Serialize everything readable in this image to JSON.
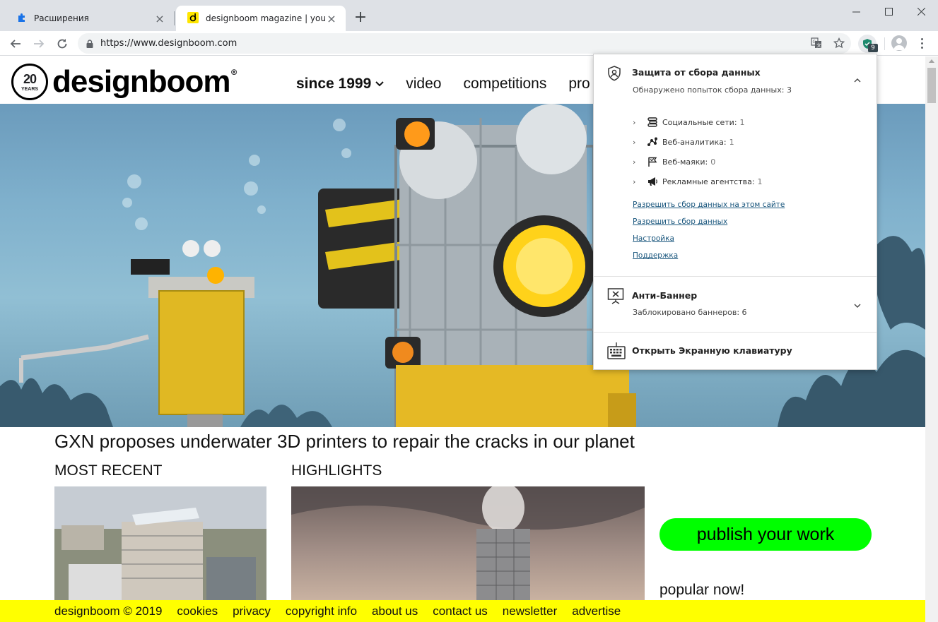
{
  "browser": {
    "tabs": [
      {
        "title": "Расширения",
        "active": false
      },
      {
        "title": "designboom magazine | your firs",
        "active": true
      }
    ],
    "url": "https://www.designboom.com",
    "extension_badge": "9"
  },
  "site": {
    "logo": {
      "years_number": "20",
      "years_label": "YEARS",
      "wordmark": "designboom",
      "registered": "®"
    },
    "nav": [
      "since 1999",
      "video",
      "competitions",
      "pro"
    ],
    "headline": "GXN proposes underwater 3D printers to repair the cracks in our planet",
    "most_recent": "MOST RECENT",
    "highlights": "HIGHLIGHTS",
    "publish_button": "publish your work",
    "popular": "popular now!",
    "footer": [
      "designboom © 2019",
      "cookies",
      "privacy",
      "copyright info",
      "about us",
      "contact us",
      "newsletter",
      "advertise"
    ]
  },
  "popup": {
    "tracking": {
      "title": "Защита от сбора данных",
      "subtitle": "Обнаружено попыток сбора данных: 3",
      "categories": [
        {
          "label": "Социальные сети:",
          "count": "1",
          "icon": "social-networks-icon"
        },
        {
          "label": "Веб-аналитика:",
          "count": "1",
          "icon": "web-analytics-icon"
        },
        {
          "label": "Веб-маяки:",
          "count": "0",
          "icon": "web-beacons-icon"
        },
        {
          "label": "Рекламные агентства:",
          "count": "1",
          "icon": "ad-agencies-icon"
        }
      ],
      "links": [
        "Разрешить сбор данных на этом сайте",
        "Разрешить сбор данных",
        "Настройка",
        "Поддержка"
      ]
    },
    "anti_banner": {
      "title": "Анти-Баннер",
      "subtitle": "Заблокировано баннеров: 6"
    },
    "keyboard": "Открыть Экранную клавиатуру"
  },
  "colors": {
    "publish_green": "#00ff00",
    "footer_yellow": "#ffff00",
    "link_blue": "#19567d",
    "shield_green": "#1e8a6e"
  }
}
